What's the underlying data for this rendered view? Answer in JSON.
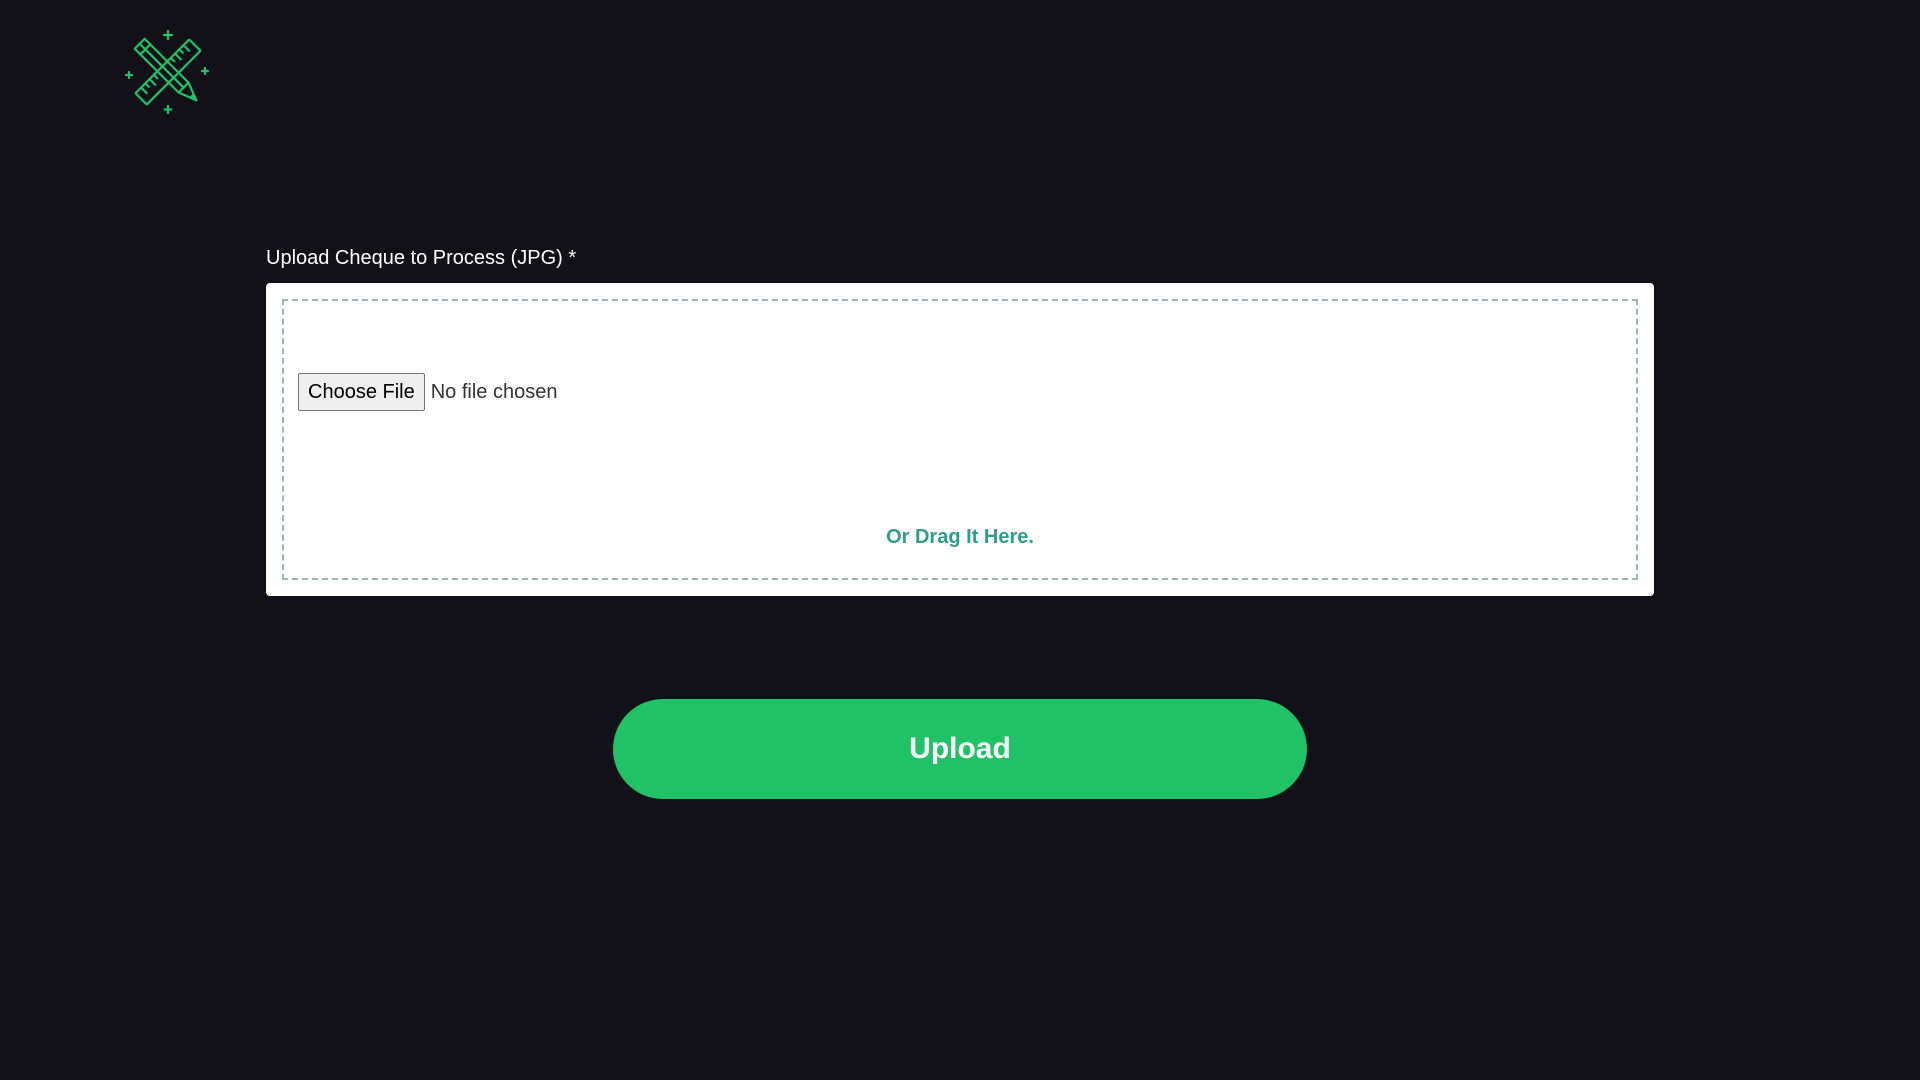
{
  "brand": {
    "logo_icon": "ruler-pencil-icon",
    "accent_color": "#1fc265"
  },
  "upload_form": {
    "label": "Upload Cheque to Process (JPG) *",
    "choose_file_label": "Choose File",
    "file_status": "No file chosen",
    "drag_hint": "Or Drag It Here.",
    "drag_hint_color": "#2e9e8c"
  },
  "actions": {
    "upload_label": "Upload"
  }
}
